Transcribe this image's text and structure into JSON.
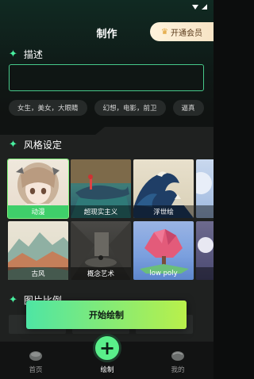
{
  "header": {
    "title": "制作",
    "vip_label": "开通会员"
  },
  "description": {
    "title": "描述",
    "value": ""
  },
  "chips": [
    "女生，美女，大眼睛",
    "幻想，电影，前卫",
    "逼真"
  ],
  "style": {
    "title": "风格设定",
    "cards": [
      {
        "label": "动漫",
        "selected": true
      },
      {
        "label": "超现实主义",
        "selected": false
      },
      {
        "label": "浮世绘",
        "selected": false
      },
      {
        "label": "",
        "selected": false
      },
      {
        "label": "古风",
        "selected": false
      },
      {
        "label": "概念艺术",
        "selected": false
      },
      {
        "label": "low poly",
        "selected": false
      },
      {
        "label": "",
        "selected": false
      }
    ]
  },
  "ratio": {
    "title": "图片比例"
  },
  "start_button": "开始绘制",
  "nav": {
    "home": "首页",
    "create": "绘制",
    "mine": "我的"
  },
  "colors": {
    "accent": "#4ee5a4",
    "accent2": "#b9f04a",
    "selected": "#3fcf6a",
    "vip_bg": "#f7e3c4"
  },
  "icons": {
    "status": [
      "wifi-icon",
      "signal-icon"
    ],
    "section": "sparkle-icon",
    "vip": "crown-icon",
    "nav": [
      "home-icon",
      "plus-icon",
      "profile-icon"
    ]
  }
}
